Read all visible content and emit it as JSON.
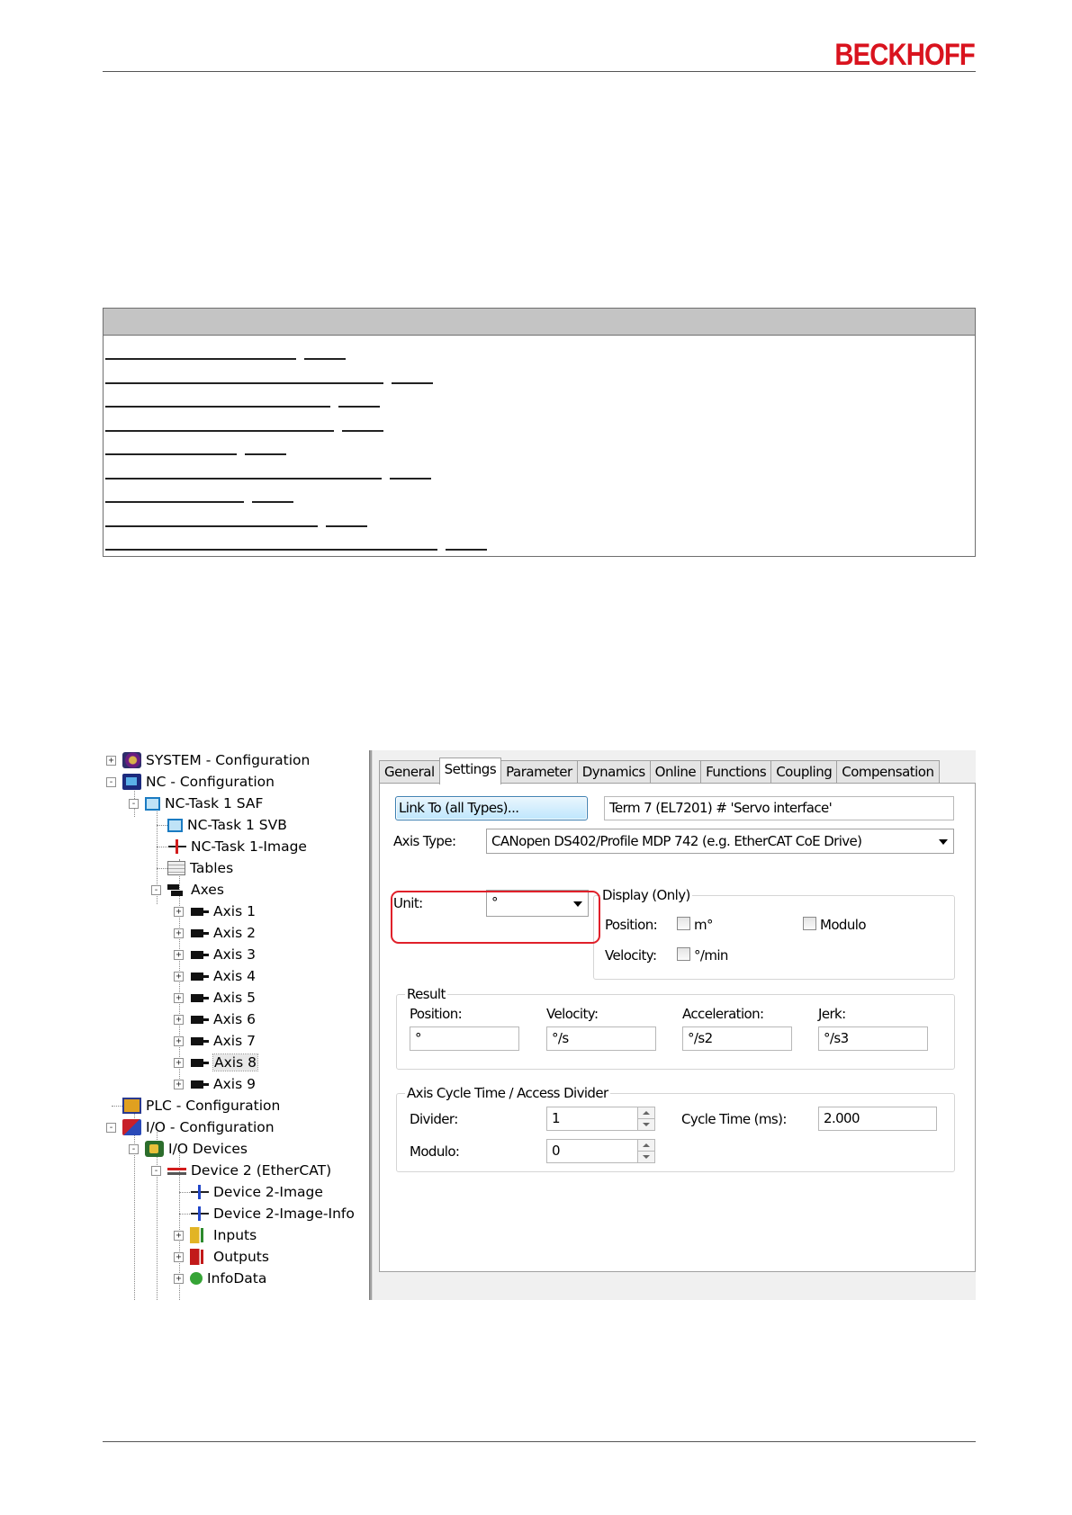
{
  "brand": {
    "logo_text": "BECKHOFF",
    "logo_color": "#d9131e"
  },
  "toc": {
    "line_count": 9
  },
  "tree": {
    "items": [
      {
        "label": "SYSTEM - Configuration",
        "icon": "system-icon",
        "expander": "+"
      },
      {
        "label": "NC - Configuration",
        "icon": "nc-icon",
        "expander": "-"
      },
      {
        "label": "NC-Task 1 SAF",
        "icon": "task-icon",
        "expander": "-"
      },
      {
        "label": "NC-Task 1 SVB",
        "icon": "task-icon",
        "expander": ""
      },
      {
        "label": "NC-Task 1-Image",
        "icon": "process-image-icon",
        "expander": ""
      },
      {
        "label": "Tables",
        "icon": "table-icon",
        "expander": ""
      },
      {
        "label": "Axes",
        "icon": "axes-icon",
        "expander": "-"
      },
      {
        "label": "Axis 1",
        "icon": "axis-icon",
        "expander": "+"
      },
      {
        "label": "Axis 2",
        "icon": "axis-icon",
        "expander": "+"
      },
      {
        "label": "Axis 3",
        "icon": "axis-icon",
        "expander": "+"
      },
      {
        "label": "Axis 4",
        "icon": "axis-icon",
        "expander": "+"
      },
      {
        "label": "Axis 5",
        "icon": "axis-icon",
        "expander": "+"
      },
      {
        "label": "Axis 6",
        "icon": "axis-icon",
        "expander": "+"
      },
      {
        "label": "Axis 7",
        "icon": "axis-icon",
        "expander": "+"
      },
      {
        "label": "Axis 8",
        "icon": "axis-icon",
        "expander": "+",
        "selected": true
      },
      {
        "label": "Axis 9",
        "icon": "axis-icon",
        "expander": "+"
      },
      {
        "label": "PLC - Configuration",
        "icon": "plc-icon",
        "expander": ""
      },
      {
        "label": "I/O - Configuration",
        "icon": "io-icon",
        "expander": "-"
      },
      {
        "label": "I/O Devices",
        "icon": "devices-icon",
        "expander": "-"
      },
      {
        "label": "Device 2 (EtherCAT)",
        "icon": "ethercat-icon",
        "expander": "-"
      },
      {
        "label": "Device 2-Image",
        "icon": "process-image-icon",
        "expander": ""
      },
      {
        "label": "Device 2-Image-Info",
        "icon": "process-image-icon",
        "expander": ""
      },
      {
        "label": "Inputs",
        "icon": "inputs-icon",
        "expander": "+"
      },
      {
        "label": "Outputs",
        "icon": "outputs-icon",
        "expander": "+"
      },
      {
        "label": "InfoData",
        "icon": "infodata-icon",
        "expander": "+"
      }
    ]
  },
  "tabs": [
    {
      "label": "General"
    },
    {
      "label": "Settings",
      "active": true
    },
    {
      "label": "Parameter"
    },
    {
      "label": "Dynamics"
    },
    {
      "label": "Online"
    },
    {
      "label": "Functions"
    },
    {
      "label": "Coupling"
    },
    {
      "label": "Compensation"
    }
  ],
  "settings": {
    "link_button": "Link To (all Types)...",
    "link_target": "Term 7 (EL7201) # 'Servo interface'",
    "axis_type_label": "Axis Type:",
    "axis_type_value": "CANopen DS402/Profile MDP 742 (e.g. EtherCAT CoE Drive)",
    "unit_label": "Unit:",
    "unit_value": "°",
    "display": {
      "title": "Display (Only)",
      "position_label": "Position:",
      "position_check": "m°",
      "modulo_check": "Modulo",
      "velocity_label": "Velocity:",
      "velocity_check": "°/min"
    },
    "result": {
      "title": "Result",
      "position_label": "Position:",
      "position_value": "°",
      "velocity_label": "Velocity:",
      "velocity_value": "°/s",
      "acceleration_label": "Acceleration:",
      "acceleration_value": "°/s2",
      "jerk_label": "Jerk:",
      "jerk_value": "°/s3"
    },
    "cycle": {
      "title": "Axis Cycle Time / Access Divider",
      "divider_label": "Divider:",
      "divider_value": "1",
      "cycle_time_label": "Cycle Time (ms):",
      "cycle_time_value": "2.000",
      "modulo_label": "Modulo:",
      "modulo_value": "0"
    }
  },
  "highlight_color": "#e0202a"
}
